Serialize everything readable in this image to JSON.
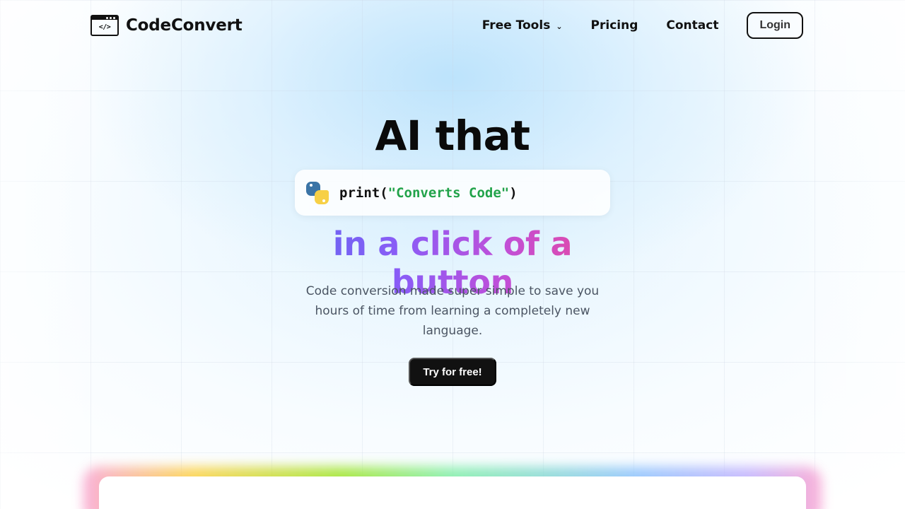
{
  "brand": {
    "name": "CodeConvert",
    "icon": "code-window-icon",
    "icon_code": "</>"
  },
  "nav": {
    "items": [
      {
        "label": "Free Tools",
        "has_dropdown": true
      },
      {
        "label": "Pricing"
      },
      {
        "label": "Contact"
      }
    ],
    "login_label": "Login"
  },
  "hero": {
    "title": "AI that",
    "code_icon": "python-logo-icon",
    "code_prefix": "print(",
    "code_string": "\"Converts Code\"",
    "code_suffix": ")",
    "tagline": "in a click of a button",
    "subtitle": "Code conversion made super simple to save you hours of time from learning a completely new language.",
    "cta_label": "Try for free!"
  },
  "colors": {
    "accent_gradient_start": "#6366f1",
    "accent_gradient_end": "#ec4899",
    "code_string": "#22a34a",
    "cta_bg": "#111111"
  }
}
